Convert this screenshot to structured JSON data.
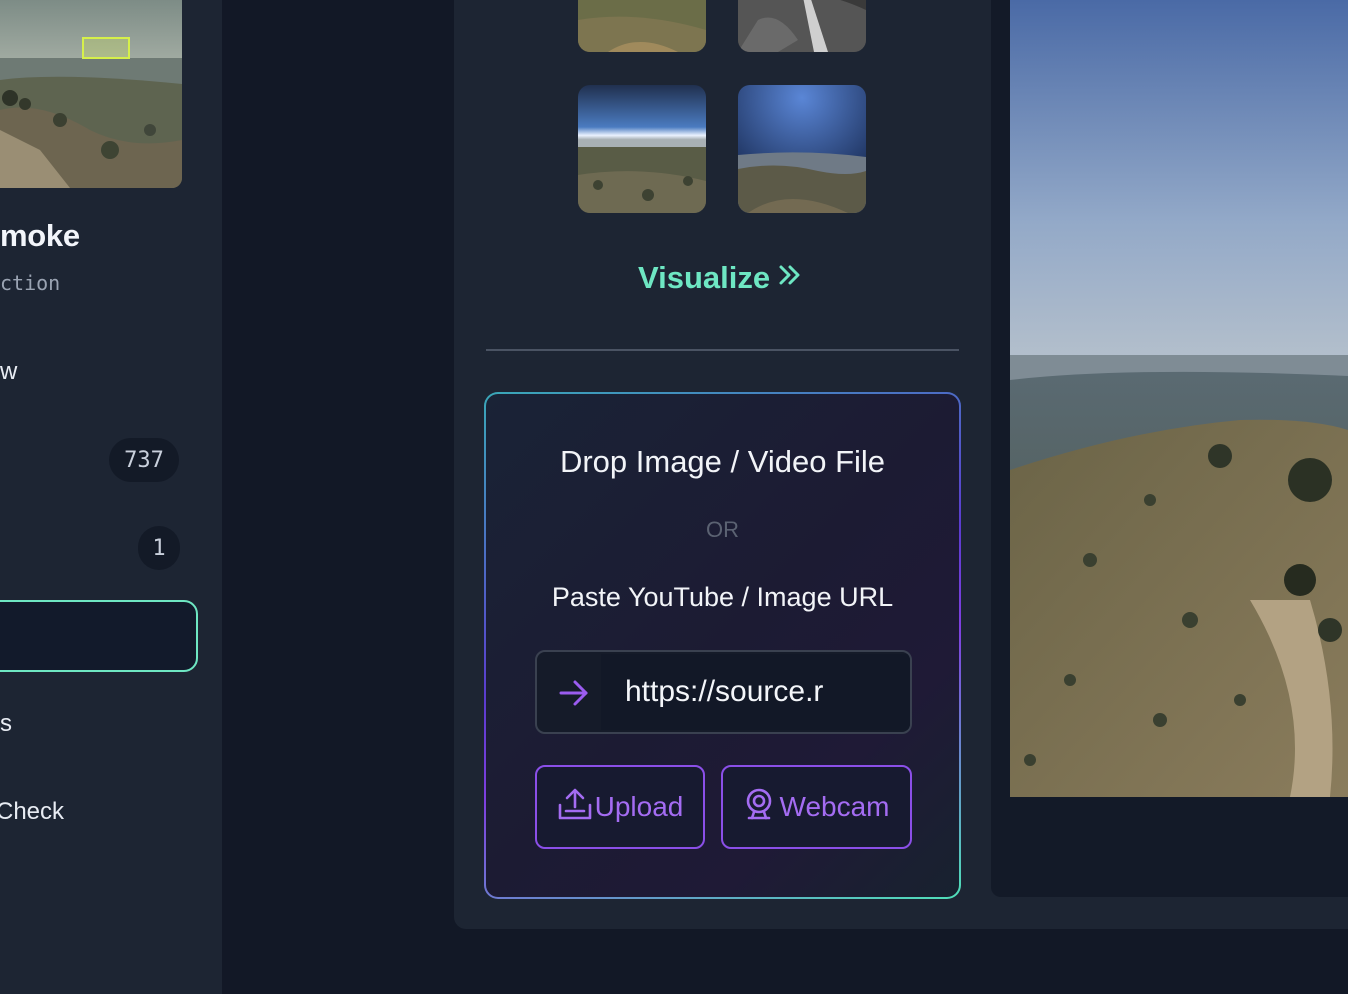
{
  "sidebar": {
    "project_title": "moke",
    "project_subtitle": "ction",
    "nav": [
      {
        "label": "w"
      },
      {
        "label": "",
        "badge": "737"
      },
      {
        "label": "",
        "badge": "1"
      },
      {
        "label": "",
        "active": true
      },
      {
        "label": "s"
      },
      {
        "label": "Check"
      }
    ]
  },
  "main": {
    "visualize_label": "Visualize",
    "dropzone": {
      "title": "Drop Image / Video File",
      "or_text": "OR",
      "paste_label": "Paste YouTube / Image URL",
      "url_value": "https://source.r",
      "upload_label": "Upload",
      "webcam_label": "Webcam"
    }
  },
  "colors": {
    "accent_teal": "#6ee7c3",
    "accent_purple": "#a46cf2",
    "panel_bg": "#1d2533",
    "page_bg": "#121826"
  },
  "icons": [
    "chevrons-right-icon",
    "arrow-right-icon",
    "upload-icon",
    "webcam-icon"
  ]
}
